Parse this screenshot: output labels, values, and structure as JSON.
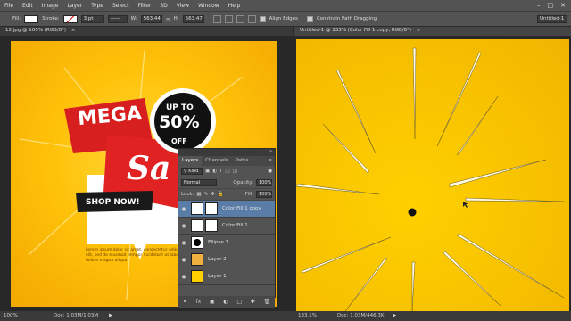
{
  "menu": [
    "File",
    "Edit",
    "Image",
    "Layer",
    "Type",
    "Select",
    "Filter",
    "3D",
    "View",
    "Window",
    "Help"
  ],
  "options": {
    "fill_label": "Fill:",
    "stroke_label": "Stroke:",
    "stroke_width": "3 pt",
    "w_label": "W:",
    "w_value": "563.44",
    "h_label": "H:",
    "h_value": "563.47",
    "align_edges": "Align Edges",
    "constrain": "Constrain Path Dragging",
    "workspace": "Untitled-1"
  },
  "docs": {
    "left_tab": "12.jpg @ 100% (RGB/8*)",
    "right_tab": "Untitled-1 @ 133% (Color Fill 1 copy, RGB/8*)"
  },
  "poster": {
    "mega": "MEGA",
    "up_to": "UP TO",
    "percent": "50%",
    "off": "OFF",
    "sale": "Sa",
    "shop_now": "SHOP NOW!",
    "lorem": "Lorem ipsum dolor sit amet, consectetur adipiscing elit, sed do eiusmod tempor incididunt ut labore et dolore magna aliqua"
  },
  "layers_panel": {
    "tabs": [
      "Layers",
      "Channels",
      "Paths"
    ],
    "kind": "Kind",
    "blend": "Normal",
    "opacity_label": "Opacity:",
    "opacity": "100%",
    "lock_label": "Lock:",
    "fill_label": "Fill:",
    "fill": "100%",
    "layers": [
      {
        "name": "Color Fill 1 copy",
        "selected": true,
        "thumb": "#ffffff"
      },
      {
        "name": "Color Fill 1",
        "selected": false,
        "thumb": "#ffffff"
      },
      {
        "name": "Ellipse 1",
        "selected": false,
        "thumb": "#ffffff"
      },
      {
        "name": "Layer 2",
        "selected": false,
        "thumb": "#f0b040"
      },
      {
        "name": "Layer 1",
        "selected": false,
        "thumb": "#ffd000"
      }
    ]
  },
  "status": {
    "left_zoom": "100%",
    "left_doc": "Doc: 1.03M/1.03M",
    "right_zoom": "133.1%",
    "right_doc": "Doc: 1.03M/446.3K"
  }
}
